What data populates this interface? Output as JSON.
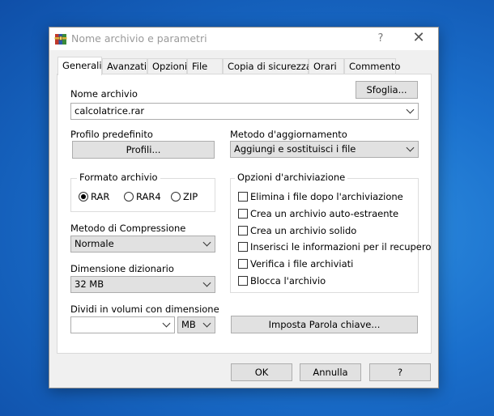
{
  "window": {
    "title": "Nome archivio e parametri",
    "help_label": "?",
    "close_label": "✕"
  },
  "tabs": [
    {
      "label": "Generali",
      "active": true
    },
    {
      "label": "Avanzati",
      "active": false
    },
    {
      "label": "Opzioni",
      "active": false
    },
    {
      "label": "File",
      "active": false
    },
    {
      "label": "Copia di sicurezza",
      "active": false
    },
    {
      "label": "Orari",
      "active": false
    },
    {
      "label": "Commento",
      "active": false
    }
  ],
  "general": {
    "archive_name_label": "Nome archivio",
    "browse_button": "Sfoglia...",
    "archive_name_value": "calcolatrice.rar",
    "default_profile_label": "Profilo predefinito",
    "profiles_button": "Profili...",
    "update_method_label": "Metodo d'aggiornamento",
    "update_method_value": "Aggiungi e sostituisci i file",
    "archive_format": {
      "title": "Formato archivio",
      "options": [
        {
          "label": "RAR",
          "selected": true
        },
        {
          "label": "RAR4",
          "selected": false
        },
        {
          "label": "ZIP",
          "selected": false
        }
      ]
    },
    "compression_method_label": "Metodo di Compressione",
    "compression_method_value": "Normale",
    "dictionary_size_label": "Dimensione dizionario",
    "dictionary_size_value": "32 MB",
    "split_volumes_label": "Dividi in volumi con dimensione",
    "split_volumes_value": "",
    "split_unit_value": "MB",
    "archiving_options": {
      "title": "Opzioni d'archiviazione",
      "items": [
        {
          "label": "Elimina i file dopo l'archiviazione",
          "checked": false
        },
        {
          "label": "Crea un archivio auto-estraente",
          "checked": false
        },
        {
          "label": "Crea un archivio solido",
          "checked": false
        },
        {
          "label": "Inserisci le informazioni per il recupero",
          "checked": false
        },
        {
          "label": "Verifica i file archiviati",
          "checked": false
        },
        {
          "label": "Blocca l'archivio",
          "checked": false
        }
      ]
    },
    "set_password_button": "Imposta Parola chiave..."
  },
  "footer": {
    "ok": "OK",
    "cancel": "Annulla",
    "help": "?"
  }
}
